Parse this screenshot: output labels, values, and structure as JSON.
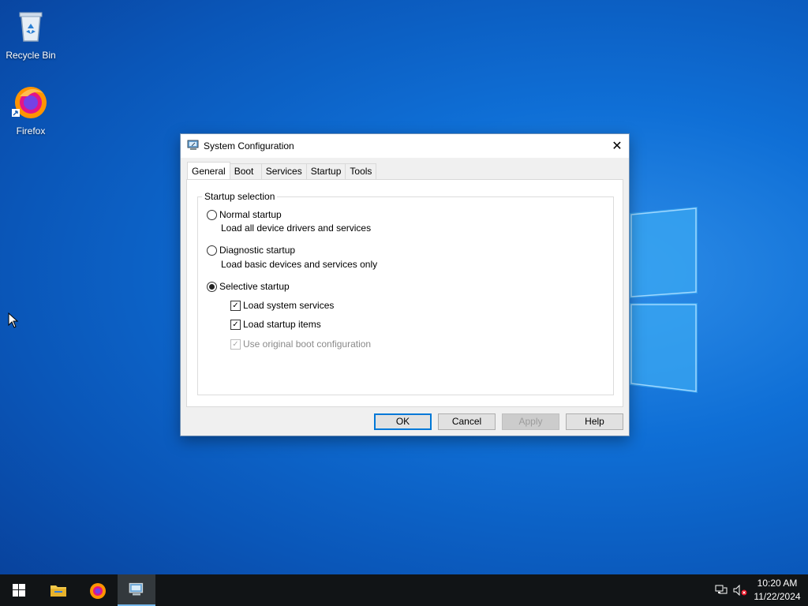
{
  "desktop": {
    "icons": [
      {
        "label": "Recycle Bin",
        "icon": "recycle-bin-icon"
      },
      {
        "label": "Firefox",
        "icon": "firefox-icon"
      }
    ]
  },
  "dialog": {
    "title": "System Configuration",
    "tabs": [
      {
        "label": "General",
        "active": true
      },
      {
        "label": "Boot",
        "active": false
      },
      {
        "label": "Services",
        "active": false
      },
      {
        "label": "Startup",
        "active": false
      },
      {
        "label": "Tools",
        "active": false
      }
    ],
    "group_title": "Startup selection",
    "normal": {
      "label": "Normal startup",
      "desc": "Load all device drivers and services",
      "selected": false
    },
    "diagnostic": {
      "label": "Diagnostic startup",
      "desc": "Load basic devices and services only",
      "selected": false
    },
    "selective": {
      "label": "Selective startup",
      "selected": true,
      "options": [
        {
          "label": "Load system services",
          "checked": true,
          "enabled": true
        },
        {
          "label": "Load startup items",
          "checked": true,
          "enabled": true
        },
        {
          "label": "Use original boot configuration",
          "checked": true,
          "enabled": false
        }
      ]
    },
    "buttons": {
      "ok": "OK",
      "cancel": "Cancel",
      "apply": "Apply",
      "help": "Help"
    }
  },
  "taskbar": {
    "items": [
      "start-icon",
      "file-explorer-icon",
      "firefox-icon",
      "system-configuration-icon"
    ],
    "tray": {
      "time": "10:20 AM",
      "date": "11/22/2024"
    }
  },
  "colors": {
    "accent": "#0078d7",
    "desktop": "#0f6fd6",
    "taskbar": "#111416"
  }
}
